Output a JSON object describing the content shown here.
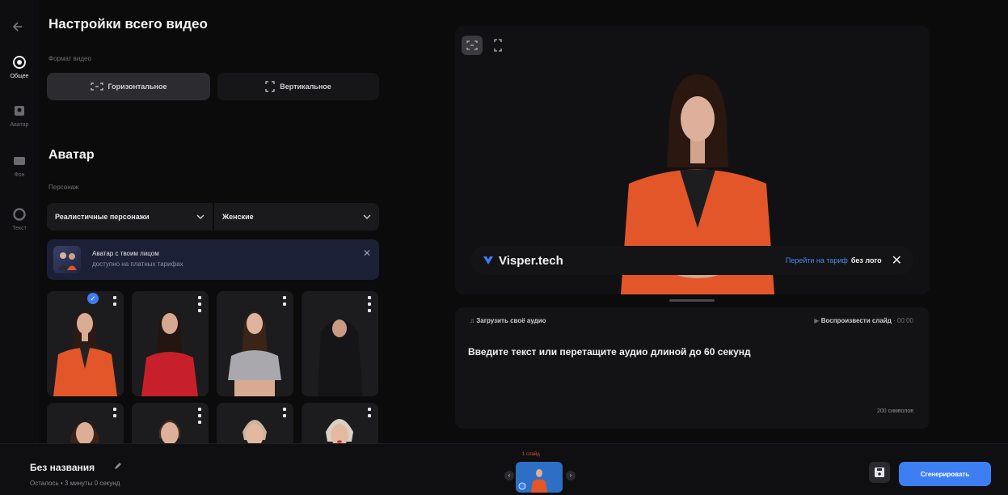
{
  "rail": {
    "items": [
      {
        "label": "Общее",
        "icon": "general-icon",
        "active": true
      },
      {
        "label": "Аватар",
        "icon": "avatar-icon",
        "active": false
      },
      {
        "label": "Фон",
        "icon": "background-icon",
        "active": false
      },
      {
        "label": "Текст",
        "icon": "text-icon",
        "active": false
      }
    ]
  },
  "settings": {
    "title": "Настройки всего видео",
    "format_label": "Формат видео",
    "horizontal": "Горизонтальное",
    "vertical": "Вертикальное"
  },
  "avatar": {
    "title": "Аватар",
    "character_label": "Персонаж",
    "type_select": "Реалистичные персонажи",
    "gender_select": "Женские",
    "banner_title": "Аватар с твоим лицом",
    "banner_sub": "доступно на платных тарифах"
  },
  "preview": {
    "brand": "Visper.tech",
    "plan_link": "Перейти на тариф",
    "plan_suffix": "без лого"
  },
  "script": {
    "upload_audio": "Загрузить своё аудио",
    "play_slide": "Воспроизвести слайд",
    "time": "00:00",
    "placeholder": "Введите текст или перетащите аудио длиной до 60 секунд",
    "char_count": "200 символов"
  },
  "bottom": {
    "title": "Без названия",
    "remaining": "Осталось • 3 минуты 0 секунд",
    "slide_label": "1 слайд",
    "generate": "Сгенерировать"
  },
  "colors": {
    "accent": "#3d7ef3",
    "jacket": "#e2562a",
    "banner_bg": "#1c2036"
  }
}
